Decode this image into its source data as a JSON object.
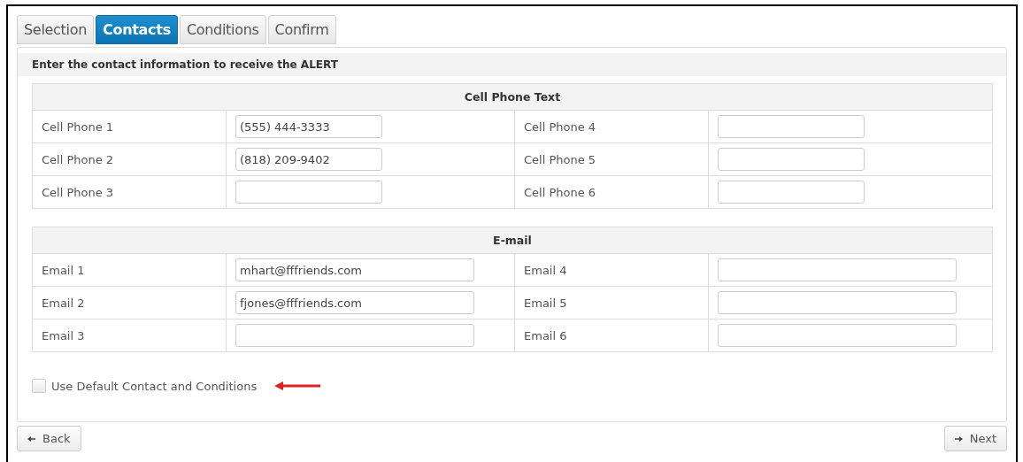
{
  "tabs": [
    {
      "label": "Selection",
      "selected": false
    },
    {
      "label": "Contacts",
      "selected": true
    },
    {
      "label": "Conditions",
      "selected": false
    },
    {
      "label": "Confirm",
      "selected": false
    }
  ],
  "instruction": "Enter the contact information to receive the ALERT",
  "sections": [
    {
      "title": "Cell Phone Text",
      "kind": "phone",
      "fields": [
        {
          "label": "Cell Phone 1",
          "value": "(555) 444-3333"
        },
        {
          "label": "Cell Phone 2",
          "value": "(818) 209-9402"
        },
        {
          "label": "Cell Phone 3"
        },
        {
          "label": "Cell Phone 4"
        },
        {
          "label": "Cell Phone 5"
        },
        {
          "label": "Cell Phone 6"
        }
      ]
    },
    {
      "title": "E-mail",
      "kind": "email",
      "fields": [
        {
          "label": "Email 1",
          "value": "mhart@fffriends.com"
        },
        {
          "label": "Email 2",
          "value": "fjones@fffriends.com"
        },
        {
          "label": "Email 3"
        },
        {
          "label": "Email 4"
        },
        {
          "label": "Email 5"
        },
        {
          "label": "Email 6"
        }
      ]
    }
  ],
  "default_option": {
    "label": "Use Default Contact and Conditions",
    "checked": false
  },
  "buttons": [
    {
      "label": "Back",
      "kind": "back"
    },
    {
      "label": "Next",
      "kind": "next"
    }
  ]
}
